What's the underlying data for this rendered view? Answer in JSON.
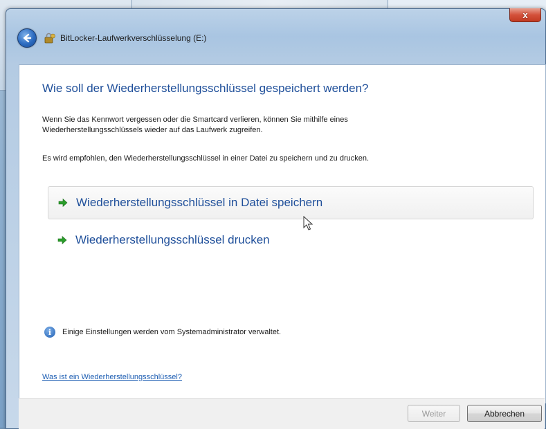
{
  "window": {
    "title": "BitLocker-Laufwerkverschlüsselung (E:)",
    "close_label": "x"
  },
  "main": {
    "heading": "Wie soll der Wiederherstellungsschlüssel gespeichert werden?",
    "intro_line1": "Wenn Sie das Kennwort vergessen oder die Smartcard verlieren, können Sie mithilfe eines",
    "intro_line2": "Wiederherstellungsschlüssels wieder auf das Laufwerk zugreifen.",
    "recommendation": "Es wird empfohlen, den Wiederherstellungsschlüssel in einer Datei zu speichern und zu drucken.",
    "options": [
      {
        "label": "Wiederherstellungsschlüssel in Datei speichern",
        "icon": "green-arrow-icon"
      },
      {
        "label": "Wiederherstellungsschlüssel drucken",
        "icon": "green-arrow-icon"
      }
    ],
    "info_text": "Einige Einstellungen werden vom Systemadministrator verwaltet.",
    "help_link": "Was ist ein Wiederherstellungsschlüssel?"
  },
  "footer": {
    "next_label": "Weiter",
    "cancel_label": "Abbrechen"
  },
  "colors": {
    "link_blue": "#1f4f9a",
    "arrow_green": "#2a9d2a",
    "close_red": "#c23a22"
  }
}
